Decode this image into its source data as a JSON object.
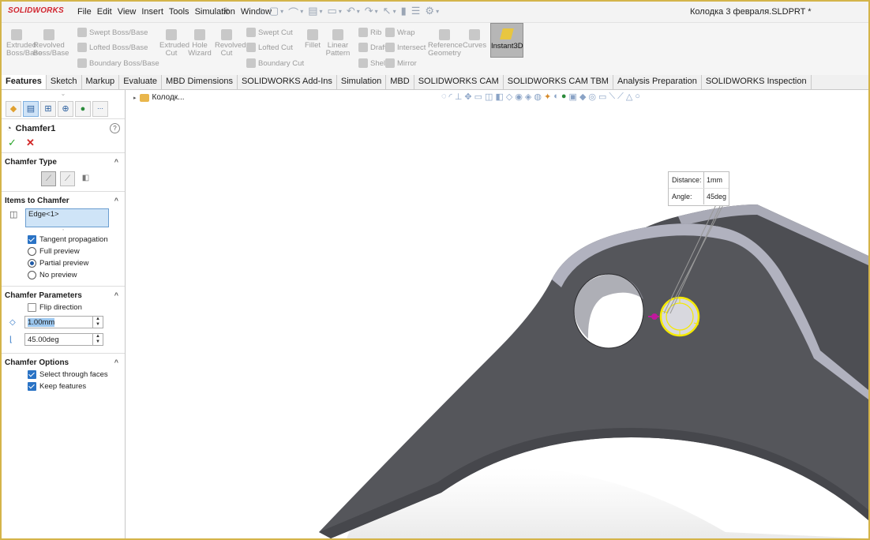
{
  "app": {
    "brand": "SOLIDWORKS",
    "document_title": "Колодка 3 февраля.SLDPRT *"
  },
  "menu": [
    "File",
    "Edit",
    "View",
    "Insert",
    "Tools",
    "Simulation",
    "Window"
  ],
  "command_manager": {
    "extruded_boss": "Extruded Boss/Base",
    "revolved_boss": "Revolved Boss/Base",
    "swept_boss": "Swept Boss/Base",
    "lofted_boss": "Lofted Boss/Base",
    "boundary_boss": "Boundary Boss/Base",
    "extruded_cut": "Extruded Cut",
    "hole_wizard": "Hole Wizard",
    "revolved_cut": "Revolved Cut",
    "swept_cut": "Swept Cut",
    "lofted_cut": "Lofted Cut",
    "boundary_cut": "Boundary Cut",
    "fillet": "Fillet",
    "linear_pattern": "Linear Pattern",
    "rib": "Rib",
    "draft": "Draft",
    "shell": "Shell",
    "wrap": "Wrap",
    "intersect": "Intersect",
    "mirror": "Mirror",
    "reference_geometry": "Reference Geometry",
    "curves": "Curves",
    "instant3d": "Instant3D"
  },
  "tabs": [
    "Features",
    "Sketch",
    "Markup",
    "Evaluate",
    "MBD Dimensions",
    "SOLIDWORKS Add-Ins",
    "Simulation",
    "MBD",
    "SOLIDWORKS CAM",
    "SOLIDWORKS CAM TBM",
    "Analysis Preparation",
    "SOLIDWORKS Inspection"
  ],
  "panel": {
    "feature_name": "Chamfer1",
    "chamfer_type": {
      "title": "Chamfer Type"
    },
    "items": {
      "title": "Items to Chamfer",
      "edge": "Edge<1>",
      "tangent": "Tangent propagation",
      "full_preview": "Full preview",
      "partial_preview": "Partial preview",
      "no_preview": "No preview"
    },
    "params": {
      "title": "Chamfer Parameters",
      "flip": "Flip direction",
      "distance": "1.00mm",
      "angle": "45.00deg"
    },
    "options": {
      "title": "Chamfer Options",
      "select_through": "Select through faces",
      "keep_features": "Keep features"
    }
  },
  "viewport": {
    "tree_item": "Колодк...",
    "callout": {
      "distance_label": "Distance:",
      "distance_value": "1mm",
      "angle_label": "Angle:",
      "angle_value": "45deg"
    }
  },
  "colors": {
    "part_face": "#55565b",
    "part_edge": "#a9aab6",
    "highlight": "#f5ea00",
    "accent": "#d22630"
  }
}
